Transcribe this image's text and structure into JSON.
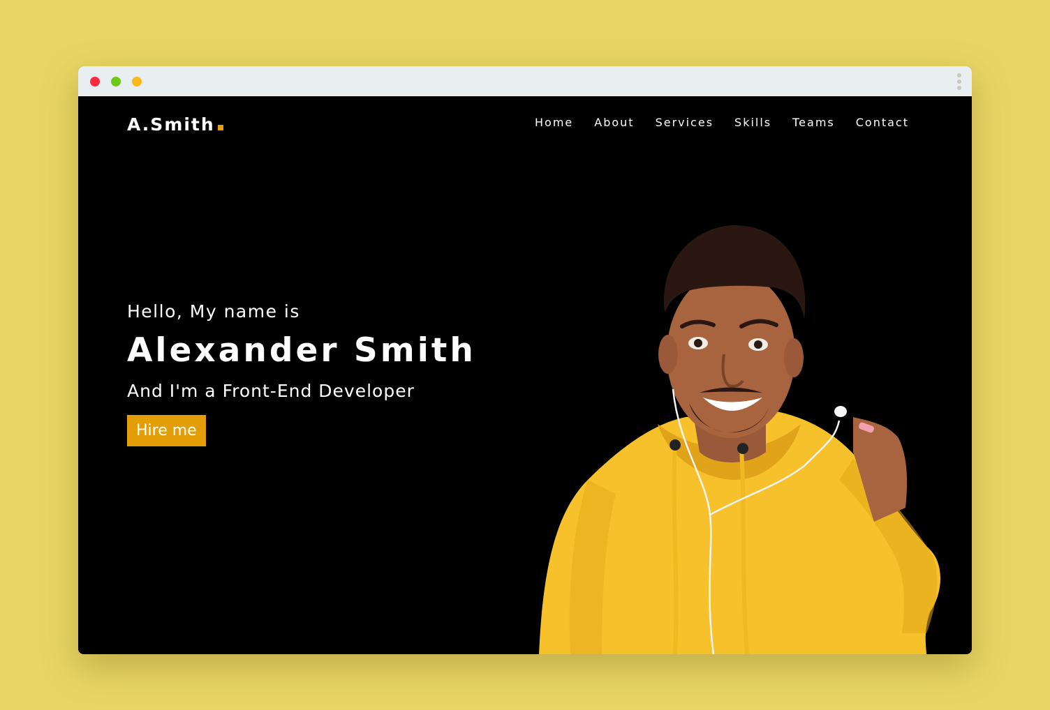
{
  "browser": {
    "controls": [
      "close",
      "minimize",
      "maximize"
    ],
    "menu_icon": "kebab-icon"
  },
  "header": {
    "logo": "A.Smith"
  },
  "nav": {
    "items": [
      "Home",
      "About",
      "Services",
      "Skills",
      "Teams",
      "Contact"
    ]
  },
  "hero": {
    "greeting": "Hello, My name is",
    "name": "Alexander Smith",
    "role": "And I'm a Front-End Developer",
    "cta_label": "Hire me"
  },
  "colors": {
    "background": "#e8d565",
    "page": "#000000",
    "accent": "#e39d07",
    "hoodie": "#f6c12a"
  }
}
